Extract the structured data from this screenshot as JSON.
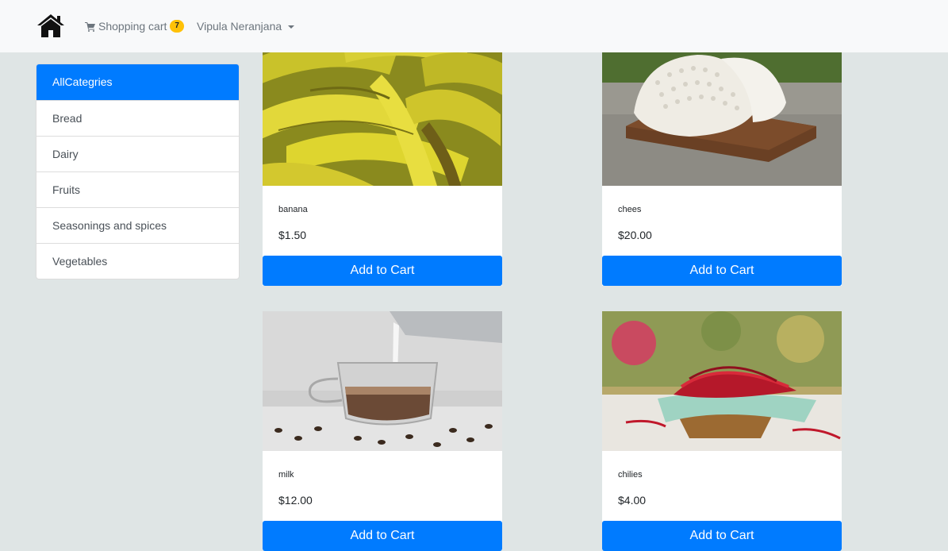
{
  "navbar": {
    "home_icon": "home-icon",
    "cart_icon": "shopping-cart-icon",
    "cart_label": "Shopping cart",
    "cart_count": "7",
    "user_name": "Vipula Neranjana"
  },
  "sidebar": {
    "items": [
      {
        "label": "AllCategries",
        "active": true
      },
      {
        "label": "Bread"
      },
      {
        "label": "Dairy"
      },
      {
        "label": "Fruits"
      },
      {
        "label": "Seasonings and spices"
      },
      {
        "label": "Vegetables"
      }
    ]
  },
  "products": [
    {
      "name": "banana",
      "price": "$1.50",
      "button": "Add to Cart"
    },
    {
      "name": "chees",
      "price": "$20.00",
      "button": "Add to Cart"
    },
    {
      "name": "milk",
      "price": "$12.00",
      "button": "Add to Cart"
    },
    {
      "name": "chilies",
      "price": "$4.00",
      "button": "Add to Cart"
    }
  ],
  "colors": {
    "primary": "#007bff",
    "badge": "#ffc107",
    "page_background": "#dfe5e5",
    "navbar": "#f8f9fa"
  }
}
